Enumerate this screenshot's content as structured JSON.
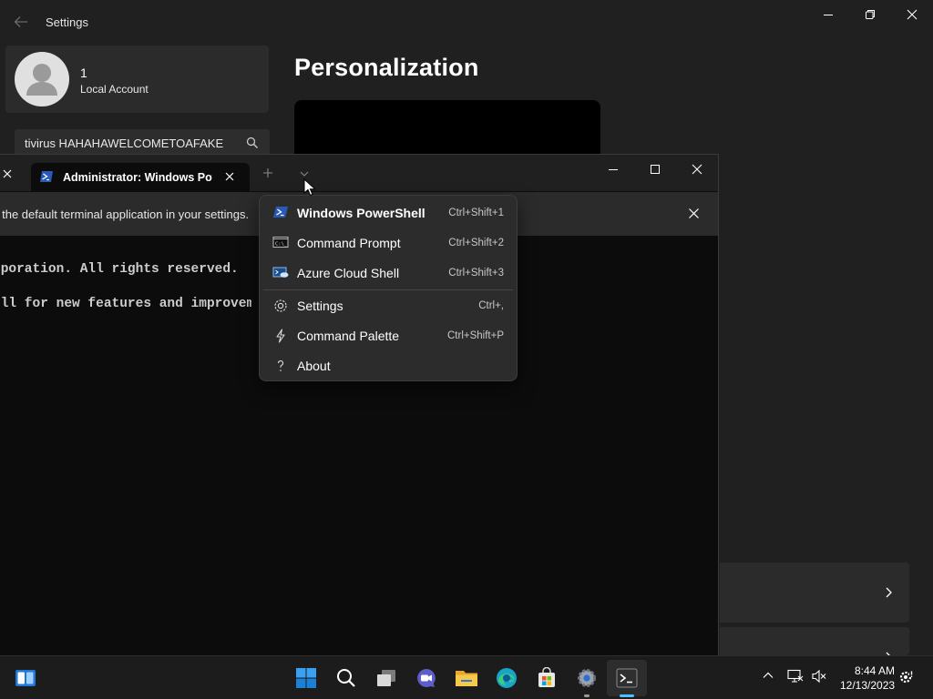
{
  "settings_window": {
    "title": "Settings",
    "account": {
      "name": "1",
      "type": "Local Account"
    },
    "search": {
      "value": "tivirus HAHAHAWELCOMETOAFAKE"
    },
    "page_heading": "Personalization"
  },
  "terminal_window": {
    "tab_title": "Administrator: Windows PowerShell",
    "infobar_text": "s the default terminal application in your settings.",
    "lines": [
      "rporation. All rights reserved.",
      "ell for new features and improvements!"
    ]
  },
  "dropdown_menu": {
    "items": [
      {
        "label": "Windows PowerShell",
        "shortcut": "Ctrl+Shift+1",
        "icon": "powershell-icon"
      },
      {
        "label": "Command Prompt",
        "shortcut": "Ctrl+Shift+2",
        "icon": "command-prompt-icon"
      },
      {
        "label": "Azure Cloud Shell",
        "shortcut": "Ctrl+Shift+3",
        "icon": "azure-cloud-shell-icon"
      },
      {
        "label": "Settings",
        "shortcut": "Ctrl+,",
        "icon": "gear-icon"
      },
      {
        "label": "Command Palette",
        "shortcut": "Ctrl+Shift+P",
        "icon": "lightning-icon"
      },
      {
        "label": "About",
        "shortcut": "",
        "icon": "question-icon"
      }
    ]
  },
  "taskbar": {
    "clock_time": "8:44 AM",
    "clock_date": "12/13/2023"
  },
  "colors": {
    "accent": "#4cc2ff",
    "background": "#202020",
    "terminal_bg": "#0c0c0c"
  }
}
